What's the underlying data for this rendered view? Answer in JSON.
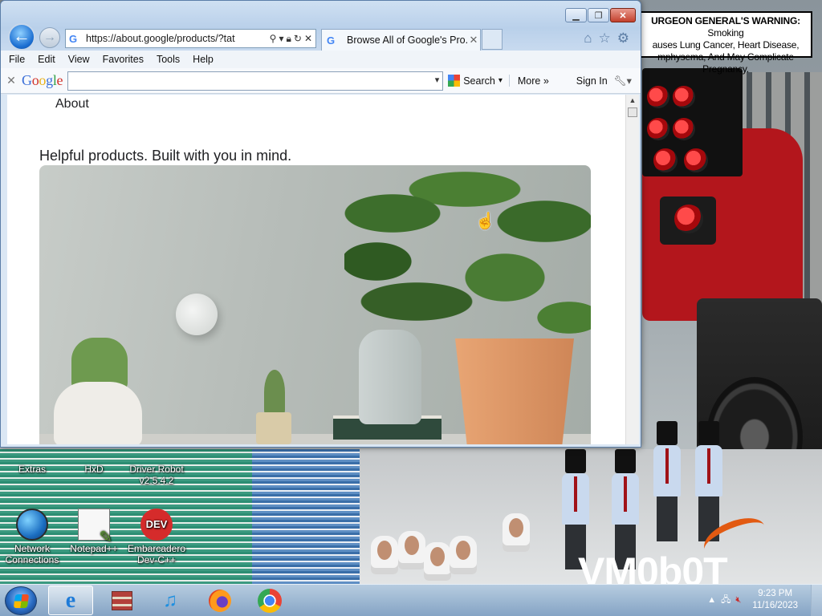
{
  "desktop": {
    "warning_title": "URGEON GENERAL'S WARNING:",
    "warning_text": "Smoking\nauses Lung Cancer, Heart Disease,\nmphysema, And May Complicate Pregnancy.",
    "watermark": "VM0b0T",
    "icons": [
      {
        "label": "Extras"
      },
      {
        "label": "HxD"
      },
      {
        "label": "Driver Robot v2.5.4.2"
      },
      {
        "label": "Network Connections"
      },
      {
        "label": "Notepad++"
      },
      {
        "label": "Embarcadero Dev-C++"
      }
    ]
  },
  "browser": {
    "address_url": "https://about.google/products/?tat",
    "tab_title": "Browse All of Google's Pro...",
    "menu": [
      "File",
      "Edit",
      "View",
      "Favorites",
      "Tools",
      "Help"
    ],
    "google_toolbar": {
      "logo": "Google",
      "search_label": "Search",
      "more_label": "More",
      "signin_label": "Sign In"
    }
  },
  "page": {
    "nav_title": "About",
    "tagline": "Helpful products. Built with you in mind."
  },
  "taskbar": {
    "time": "9:23 PM",
    "date": "11/16/2023"
  }
}
